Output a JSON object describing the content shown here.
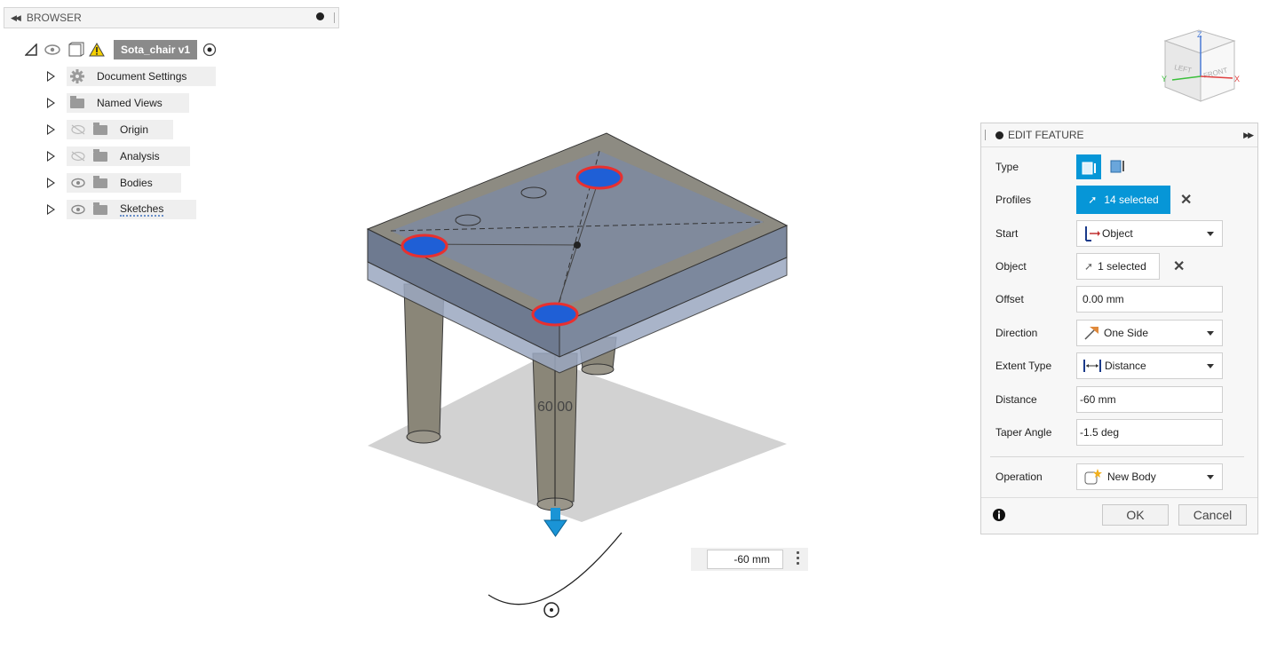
{
  "browser": {
    "title": "BROWSER",
    "root": {
      "name": "Sota_chair v1"
    },
    "items": [
      {
        "label": "Document Settings",
        "icon": "gear-icon",
        "visible": null
      },
      {
        "label": "Named Views",
        "icon": "folder-icon",
        "visible": null
      },
      {
        "label": "Origin",
        "icon": "folder-icon",
        "visible": false
      },
      {
        "label": "Analysis",
        "icon": "folder-icon",
        "visible": false
      },
      {
        "label": "Bodies",
        "icon": "folder-icon",
        "visible": true
      },
      {
        "label": "Sketches",
        "icon": "folder-icon",
        "visible": true
      }
    ]
  },
  "viewcube": {
    "left": "LEFT",
    "front": "FRONT",
    "axis_x": "X",
    "axis_y": "Y",
    "axis_z": "Z"
  },
  "viewport": {
    "dimension_label": "60.00",
    "distance_input": "-60 mm"
  },
  "edit_feature": {
    "title": "EDIT FEATURE",
    "type_label": "Type",
    "profiles_label": "Profiles",
    "profiles_value": "14 selected",
    "start_label": "Start",
    "start_value": "Object",
    "object_label": "Object",
    "object_value": "1 selected",
    "offset_label": "Offset",
    "offset_value": "0.00 mm",
    "direction_label": "Direction",
    "direction_value": "One Side",
    "extent_label": "Extent Type",
    "extent_value": "Distance",
    "distance_label": "Distance",
    "distance_value": "-60 mm",
    "taper_label": "Taper Angle",
    "taper_value": "-1.5 deg",
    "operation_label": "Operation",
    "operation_value": "New Body",
    "ok": "OK",
    "cancel": "Cancel"
  },
  "colors": {
    "accent": "#0696d7",
    "highlight_red": "#e8302f",
    "profile_blue": "#1f5fd6"
  }
}
